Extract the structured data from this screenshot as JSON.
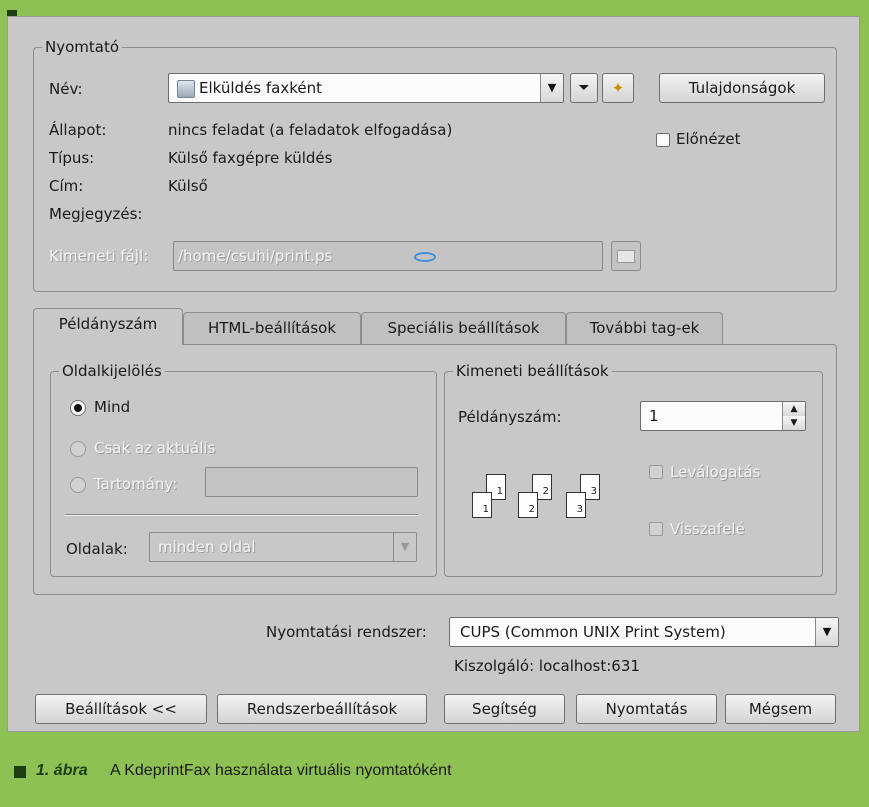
{
  "printer_group": {
    "legend": "Nyomtató",
    "name_label": "Név:",
    "name_value": "Elküldés faxként",
    "properties_button": "Tulajdonságok",
    "preview_label": "Előnézet",
    "status_label": "Állapot:",
    "status_value": "nincs feladat (a feladatok elfogadása)",
    "type_label": "Típus:",
    "type_value": "Külső faxgépre küldés",
    "address_label": "Cím:",
    "address_value": "Külső",
    "comment_label": "Megjegyzés:",
    "output_file_label": "Kimeneti fájl:",
    "output_file_value": "/home/csuhi/print.ps"
  },
  "tabs": [
    {
      "label": "Példányszám",
      "active": true
    },
    {
      "label": "HTML-beállítások",
      "active": false
    },
    {
      "label": "Speciális beállítások",
      "active": false
    },
    {
      "label": "További tag-ek",
      "active": false
    }
  ],
  "page_selection": {
    "legend": "Oldalkijelölés",
    "all_label": "Mind",
    "current_label": "Csak az aktuális",
    "range_label": "Tartomány:",
    "pages_label": "Oldalak:",
    "pages_value": "minden oldal"
  },
  "output_settings": {
    "legend": "Kimeneti beállítások",
    "copies_label": "Példányszám:",
    "copies_value": "1",
    "collate_label": "Leválogatás",
    "reverse_label": "Visszafelé",
    "page_numbers": [
      "1",
      "1",
      "2",
      "2",
      "3",
      "3"
    ]
  },
  "print_system": {
    "label": "Nyomtatási rendszer:",
    "value": "CUPS (Common UNIX Print System)",
    "server": "Kiszolgáló: localhost:631"
  },
  "buttons": {
    "settings": "Beállítások <<",
    "system_settings": "Rendszerbeállítások",
    "help": "Segítség",
    "print": "Nyomtatás",
    "cancel": "Mégsem"
  },
  "caption": {
    "number": "1. ábra",
    "text": "A KdeprintFax használata virtuális nyomtatóként"
  },
  "colors": {
    "background": "#8dc153",
    "dialog": "#c8c8c8",
    "caption_square": "#1d3d12"
  }
}
